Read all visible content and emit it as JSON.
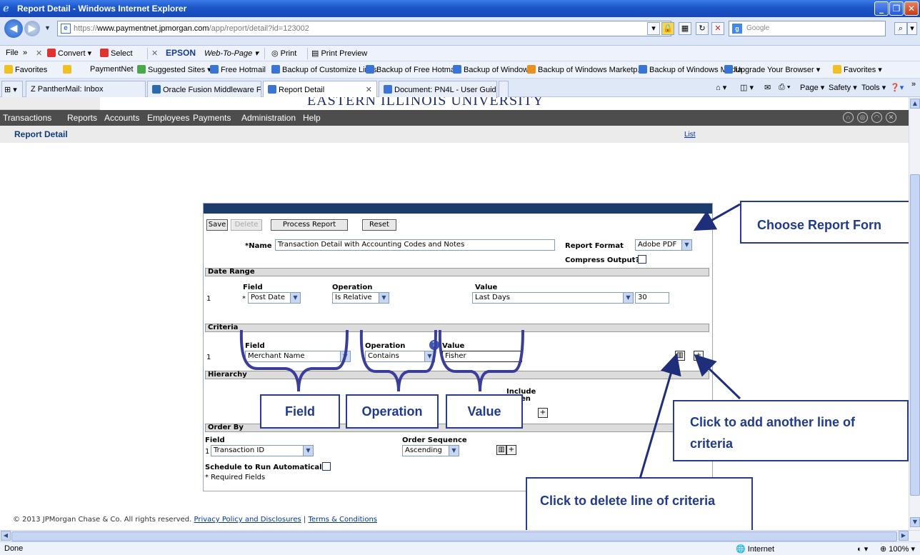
{
  "window": {
    "title": "Report Detail - Windows Internet Explorer"
  },
  "address": {
    "url_prefix": "https://",
    "url_domain": "www.paymentnet.jpmorgan.com",
    "url_path": "/app/report/detail?id=123002",
    "search_placeholder": "Google"
  },
  "menu": {
    "file": "File",
    "convert": "Convert",
    "select": "Select",
    "epson": "EPSON",
    "web_to_page": "Web-To-Page",
    "print": "Print",
    "print_preview": "Print Preview"
  },
  "favorites": {
    "label": "Favorites",
    "items": [
      "PaymentNet",
      "Suggested Sites",
      "Free Hotmail",
      "Backup of Customize Links",
      "Backup of Free Hotmail",
      "Backup of Windows",
      "Backup of Windows Marketp...",
      "Backup of Windows Media",
      "Upgrade Your Browser",
      "Favorites"
    ]
  },
  "tabs": [
    "Z PantherMail: Inbox",
    "Oracle Fusion Middleware Fo...",
    "Report Detail",
    "Document: PN4L - User Guid..."
  ],
  "toolbar_right": {
    "page": "Page",
    "safety": "Safety",
    "tools": "Tools"
  },
  "site": {
    "banner": "EASTERN ILLINOIS UNIVERSITY",
    "nav": [
      "Transactions",
      "Reports",
      "Accounts",
      "Employees",
      "Payments",
      "Administration",
      "Help"
    ],
    "page_title": "Report Detail",
    "list_link": "List",
    "footer": "© 2013 JPMorgan Chase & Co. All rights reserved.",
    "privacy": "Privacy Policy and Disclosures",
    "terms": "Terms & Conditions",
    "footer_sep": "|"
  },
  "form": {
    "buttons": {
      "save": "Save",
      "delete": "Delete",
      "process": "Process Report",
      "reset": "Reset"
    },
    "name_label": "*Name",
    "name_value": "Transaction Detail with Accounting Codes and Notes",
    "report_format_label": "Report Format",
    "report_format_value": "Adobe PDF",
    "compress_label": "Compress Output?",
    "date_range": {
      "title": "Date Range",
      "field_header": "Field",
      "operation_header": "Operation",
      "value_header": "Value",
      "row_num": "1",
      "required_mark": "*",
      "field": "Post Date",
      "operation": "Is Relative",
      "value": "Last Days",
      "days": "30"
    },
    "criteria": {
      "title": "Criteria",
      "field_header": "Field",
      "operation_header": "Operation",
      "value_header": "Value",
      "row_num": "1",
      "field": "Merchant Name",
      "operation": "Contains",
      "value": "Fisher"
    },
    "hierarchy": {
      "title": "Hierarchy",
      "include_a": "Include",
      "include_b": "en"
    },
    "order_by": {
      "title": "Order By",
      "field_header": "Field",
      "sequence_header": "Order Sequence",
      "row_num": "1",
      "field": "Transaction ID",
      "sequence": "Ascending"
    },
    "schedule_label": "Schedule to Run Automatically",
    "required_note": "* Required Fields"
  },
  "callouts": {
    "format": "Choose Report Forn",
    "field": "Field",
    "operation": "Operation",
    "value": "Value",
    "add": "Click to add another line of criteria",
    "delete": "Click to delete line of criteria"
  },
  "status": {
    "left": "Done",
    "zone": "Internet",
    "zoom": "100%"
  },
  "icons": [
    "ie-logo",
    "back-icon",
    "forward-icon",
    "lock-icon",
    "refresh-icon",
    "stop-icon",
    "search-icon",
    "star-icon",
    "home-icon",
    "print-icon",
    "help-icon",
    "trash-icon",
    "plus-icon"
  ]
}
